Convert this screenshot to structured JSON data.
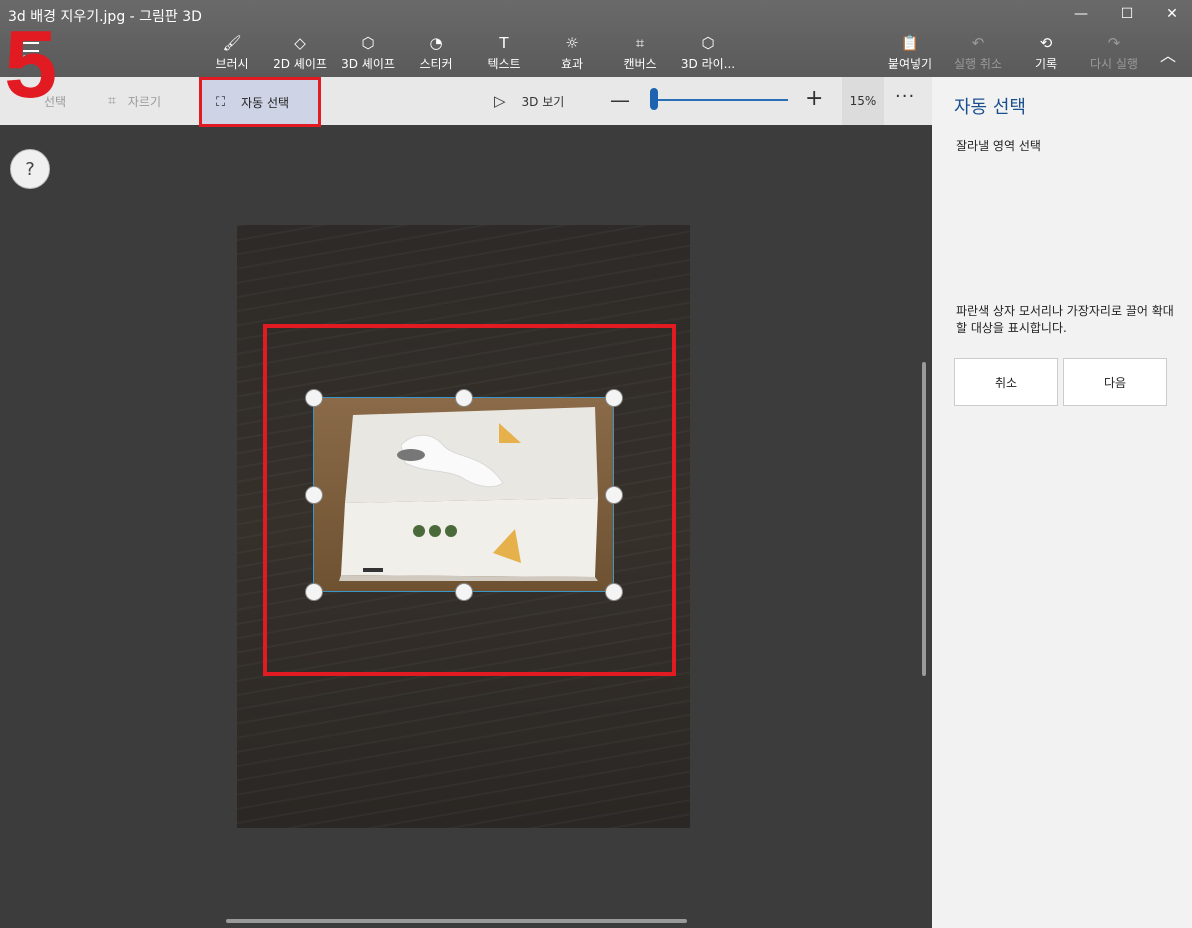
{
  "window": {
    "title": "3d 배경 지우기.jpg - 그림판 3D",
    "minimize_glyph": "—",
    "maximize_glyph": "☐",
    "close_glyph": "✕"
  },
  "step_number": "5",
  "menu": {
    "icon": "hamburger-icon",
    "label": "메뉴"
  },
  "toolbar": {
    "tools": [
      {
        "label": "브러시",
        "icon": "brush-icon",
        "glyph": "🖌"
      },
      {
        "label": "2D 셰이프",
        "icon": "2d-shapes-icon",
        "glyph": "◇"
      },
      {
        "label": "3D 셰이프",
        "icon": "3d-shapes-icon",
        "glyph": "⬡"
      },
      {
        "label": "스티커",
        "icon": "sticker-icon",
        "glyph": "◔"
      },
      {
        "label": "텍스트",
        "icon": "text-icon",
        "glyph": "T"
      },
      {
        "label": "효과",
        "icon": "effects-icon",
        "glyph": "☼"
      },
      {
        "label": "캔버스",
        "icon": "canvas-icon",
        "glyph": "⌗"
      },
      {
        "label": "3D 라이...",
        "icon": "3d-library-icon",
        "glyph": "⬡"
      }
    ],
    "right": [
      {
        "label": "붙여넣기",
        "icon": "paste-icon",
        "glyph": "📋"
      },
      {
        "label": "실행 취소",
        "icon": "undo-icon",
        "glyph": "↶"
      },
      {
        "label": "기록",
        "icon": "history-icon",
        "glyph": "⟲"
      },
      {
        "label": "다시 실행",
        "icon": "redo-icon",
        "glyph": "↷"
      }
    ],
    "collapse_glyph": "︿"
  },
  "subtoolbar": {
    "select_label": "선택",
    "crop_label": "자르기",
    "autoselect_label": "자동 선택",
    "view3d_label": "3D 보기",
    "zoom_minus": "—",
    "zoom_plus": "+",
    "zoom_level": "15%",
    "zoom_value_percent": 15,
    "more": "···"
  },
  "help": {
    "glyph": "?"
  },
  "panel": {
    "title": "자동 선택",
    "subtitle": "잘라낼 영역 선택",
    "description": "파란색 상자 모서리나 가장자리로 끌어 확대할 대상을 표시합니다.",
    "cancel_label": "취소",
    "next_label": "다음"
  },
  "colors": {
    "accent": "#1e63b0",
    "annotation_red": "#e21b23",
    "selection_blue": "#3a95c9"
  }
}
